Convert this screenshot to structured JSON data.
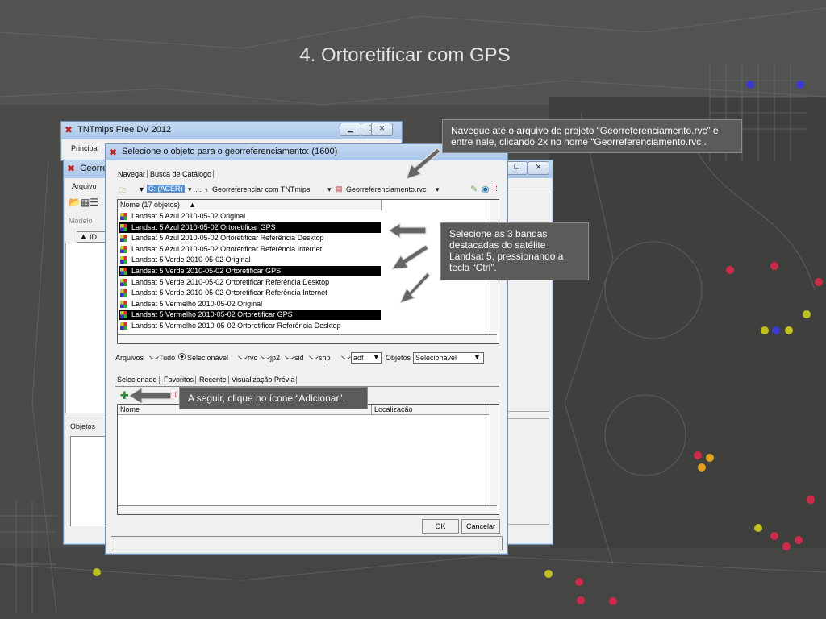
{
  "slide": {
    "title": "4. Ortoretificar com GPS"
  },
  "win_main": {
    "title": "TNTmips Free DV 2012",
    "menu": "Principal"
  },
  "win_geo": {
    "title": "Georrefe",
    "menu": "Arquivo",
    "model_label": "Modelo",
    "id_col": "ID",
    "objects_tab": "Objetos"
  },
  "dialog": {
    "title": "Selecione o objeto para o georreferenciamento: (1600)",
    "tabs": [
      "Navegar",
      "Busca de Catálogo"
    ],
    "path": {
      "drive": "C: (ACER)",
      "sep1": "...",
      "folder": "Georreferenciar com TNTmips",
      "file": "Georreferenciamento.rvc"
    },
    "list_header": "Nome  (17 objetos)",
    "items": [
      {
        "label": "Landsat 5 Azul 2010-05-02 Original",
        "selected": false
      },
      {
        "label": "Landsat 5 Azul 2010-05-02 Ortoretificar GPS",
        "selected": true
      },
      {
        "label": "Landsat 5 Azul 2010-05-02 Ortoretificar Referência Desktop",
        "selected": false
      },
      {
        "label": "Landsat 5 Azul 2010-05-02 Ortoretificar Referência Internet",
        "selected": false
      },
      {
        "label": "Landsat 5 Verde 2010-05-02 Original",
        "selected": false
      },
      {
        "label": "Landsat 5 Verde 2010-05-02 Ortoretificar GPS",
        "selected": true
      },
      {
        "label": "Landsat 5 Verde 2010-05-02 Ortoretificar Referência Desktop",
        "selected": false
      },
      {
        "label": "Landsat 5 Verde 2010-05-02 Ortoretificar Referência Internet",
        "selected": false
      },
      {
        "label": "Landsat 5 Vermelho 2010-05-02 Original",
        "selected": false
      },
      {
        "label": "Landsat 5 Vermelho 2010-05-02 Ortoretificar GPS",
        "selected": true
      },
      {
        "label": "Landsat 5 Vermelho 2010-05-02 Ortoretificar Referência Desktop",
        "selected": false
      }
    ],
    "filter": {
      "arquivos": "Arquivos",
      "tudo": "Tudo",
      "selecionavel": "Selecionável",
      "rvc": "rvc",
      "jp2": "jp2",
      "sid": "sid",
      "shp": "shp",
      "ext": "adf",
      "objetos": "Objetos",
      "objetos_value": "Selecionável"
    },
    "bottom_tabs": [
      "Selecionado",
      "Favoritos",
      "Recente",
      "Visualização Prévia"
    ],
    "sel_cols": {
      "name": "Nome",
      "location": "Localização"
    },
    "ok": "OK",
    "cancel": "Cancelar"
  },
  "callouts": {
    "navigate": "Navegue até o arquivo de projeto “Georreferenciamento.rvc” e entre nele, clicando 2x no nome “Georreferenciamento.rvc .",
    "select": "Selecione as 3 bandas destacadas do satélite Landsat 5, pressionando a tecla “Ctrl”.",
    "add": "A seguir, clique no ícone “Adicionar”."
  },
  "colors": {
    "selection": "#000000",
    "callout": "#5b5b5b",
    "title_bar": "#b9d1ee"
  }
}
